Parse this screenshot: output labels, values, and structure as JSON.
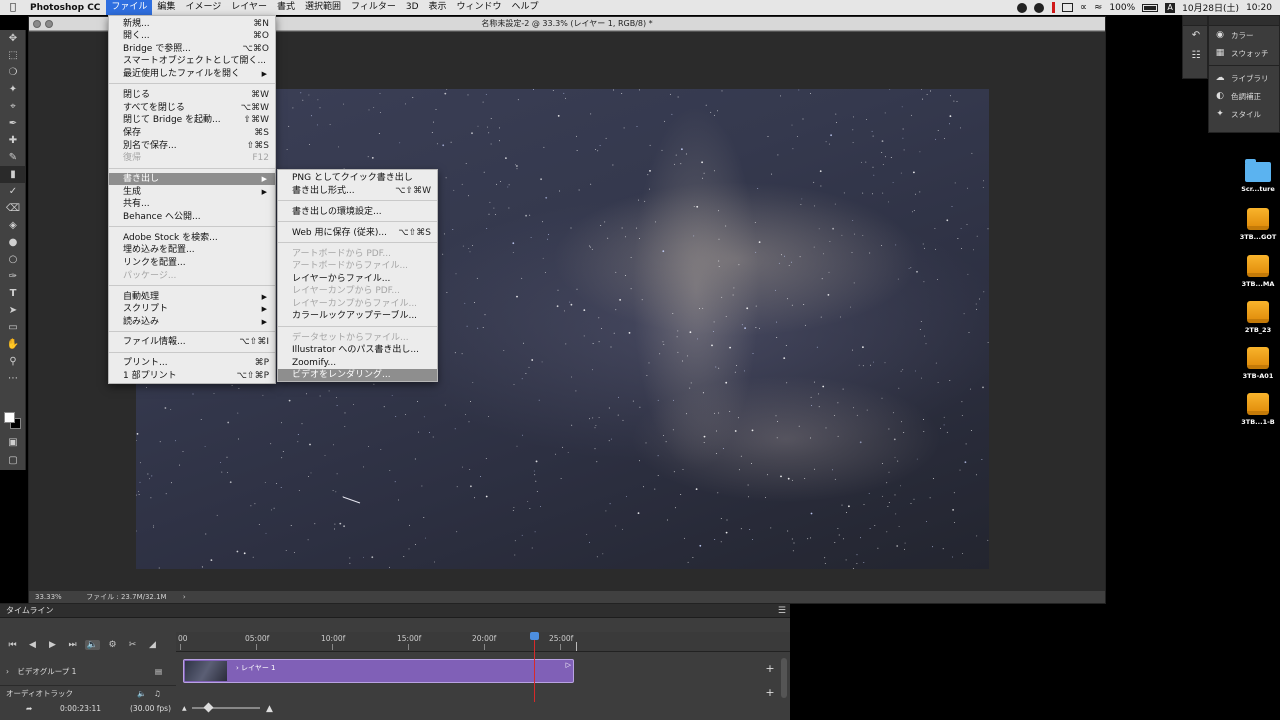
{
  "menubar": {
    "app_name": "Photoshop CC",
    "menus": [
      "ファイル",
      "編集",
      "イメージ",
      "レイヤー",
      "書式",
      "選択範囲",
      "フィルター",
      "3D",
      "表示",
      "ウィンドウ",
      "ヘルプ"
    ],
    "battery": "100%",
    "input_mode": "A",
    "date": "10月28日(土)",
    "time": "10:20"
  },
  "document": {
    "title": "名称未設定-2 @ 33.3% (レイヤー 1, RGB/8) *",
    "zoom": "33.33%",
    "file_info": "ファイル : 23.7M/32.1M"
  },
  "file_menu": {
    "items": [
      {
        "label": "新規...",
        "shortcut": "⌘N"
      },
      {
        "label": "開く...",
        "shortcut": "⌘O"
      },
      {
        "label": "Bridge で参照...",
        "shortcut": "⌥⌘O"
      },
      {
        "label": "スマートオブジェクトとして開く...",
        "shortcut": ""
      },
      {
        "label": "最近使用したファイルを開く",
        "shortcut": ""
      },
      {
        "label": "閉じる",
        "shortcut": "⌘W"
      },
      {
        "label": "すべてを閉じる",
        "shortcut": "⌥⌘W"
      },
      {
        "label": "閉じて Bridge を起動...",
        "shortcut": "⇧⌘W"
      },
      {
        "label": "保存",
        "shortcut": "⌘S"
      },
      {
        "label": "別名で保存...",
        "shortcut": "⇧⌘S"
      },
      {
        "label": "復帰",
        "shortcut": "F12"
      },
      {
        "label": "書き出し",
        "shortcut": ""
      },
      {
        "label": "生成",
        "shortcut": ""
      },
      {
        "label": "共有...",
        "shortcut": ""
      },
      {
        "label": "Behance へ公開...",
        "shortcut": ""
      },
      {
        "label": "Adobe Stock を検索...",
        "shortcut": ""
      },
      {
        "label": "埋め込みを配置...",
        "shortcut": ""
      },
      {
        "label": "リンクを配置...",
        "shortcut": ""
      },
      {
        "label": "パッケージ...",
        "shortcut": ""
      },
      {
        "label": "自動処理",
        "shortcut": ""
      },
      {
        "label": "スクリプト",
        "shortcut": ""
      },
      {
        "label": "読み込み",
        "shortcut": ""
      },
      {
        "label": "ファイル情報...",
        "shortcut": "⌥⇧⌘I"
      },
      {
        "label": "プリント...",
        "shortcut": "⌘P"
      },
      {
        "label": "1 部プリント",
        "shortcut": "⌥⇧⌘P"
      }
    ]
  },
  "export_menu": {
    "items": [
      {
        "label": "PNG としてクイック書き出し",
        "shortcut": ""
      },
      {
        "label": "書き出し形式...",
        "shortcut": "⌥⇧⌘W"
      },
      {
        "label": "書き出しの環境設定...",
        "shortcut": ""
      },
      {
        "label": "Web 用に保存 (従来)...",
        "shortcut": "⌥⇧⌘S"
      },
      {
        "label": "アートボードから PDF...",
        "shortcut": ""
      },
      {
        "label": "アートボードからファイル...",
        "shortcut": ""
      },
      {
        "label": "レイヤーからファイル...",
        "shortcut": ""
      },
      {
        "label": "レイヤーカンプから PDF...",
        "shortcut": ""
      },
      {
        "label": "レイヤーカンプからファイル...",
        "shortcut": ""
      },
      {
        "label": "カラールックアップテーブル...",
        "shortcut": ""
      },
      {
        "label": "データセットからファイル...",
        "shortcut": ""
      },
      {
        "label": "Illustrator へのパス書き出し...",
        "shortcut": ""
      },
      {
        "label": "Zoomify...",
        "shortcut": ""
      },
      {
        "label": "ビデオをレンダリング...",
        "shortcut": ""
      }
    ]
  },
  "panels": {
    "items": [
      "カラー",
      "スウォッチ",
      "ライブラリ",
      "色調補正",
      "スタイル"
    ]
  },
  "desktop": {
    "items": [
      "Scr...ture",
      "3TB...GOT",
      "3TB...MA",
      "2TB_23",
      "3TB-A01",
      "3TB...1-B"
    ]
  },
  "timeline": {
    "title": "タイムライン",
    "ticks": [
      "00",
      "05:00f",
      "10:00f",
      "15:00f",
      "20:00f",
      "25:00f"
    ],
    "video_group": "ビデオグループ 1",
    "layer_clip": "レイヤー 1",
    "audio_track": "オーディオトラック",
    "timecode": "0:00:23:11",
    "fps": "(30.00 fps)"
  }
}
